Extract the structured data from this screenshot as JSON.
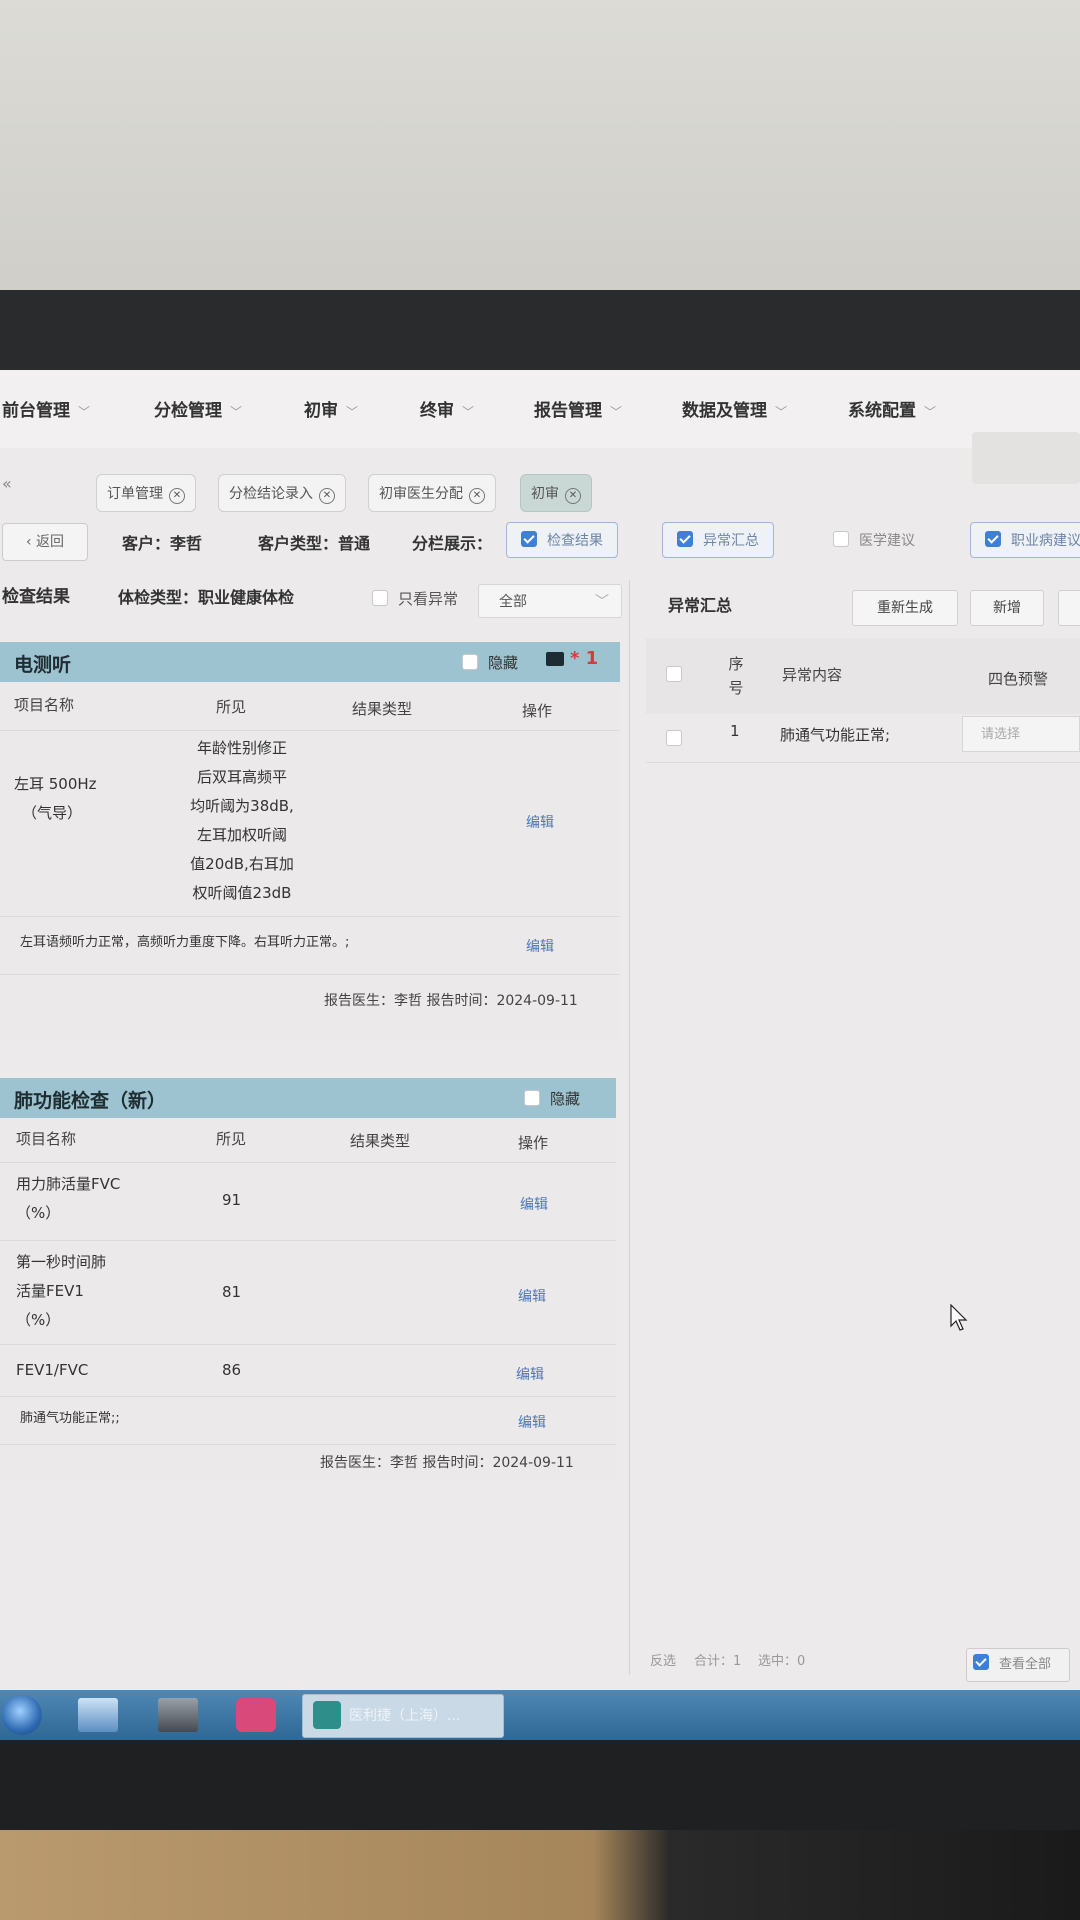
{
  "menu": [
    {
      "label": "前台管理"
    },
    {
      "label": "分检管理"
    },
    {
      "label": "初审"
    },
    {
      "label": "终审"
    },
    {
      "label": "报告管理"
    },
    {
      "label": "数据及管理"
    },
    {
      "label": "系统配置"
    }
  ],
  "collapse_symbol": "«",
  "tabs": [
    {
      "label": "订单管理"
    },
    {
      "label": "分检结论录入"
    },
    {
      "label": "初审医生分配"
    },
    {
      "label": "初审"
    }
  ],
  "customer_bar": {
    "back": "返回",
    "customer": "客户：李哲",
    "customer_type": "客户类型：普通",
    "column_display": "分栏展示：",
    "toggles": [
      {
        "label": "检查结果",
        "checked": true
      },
      {
        "label": "异常汇总",
        "checked": true
      },
      {
        "label": "医学建议",
        "checked": false
      },
      {
        "label": "职业病建议",
        "checked": true
      }
    ]
  },
  "left_panel": {
    "title": "检查结果",
    "exam_type": "体检类型：职业健康体检",
    "only_abnormal": "只看异常",
    "filter_value": "全部"
  },
  "columns": {
    "name": "项目名称",
    "finding": "所见",
    "result_type": "结果类型",
    "action": "操作"
  },
  "audiometry": {
    "title": "电测听",
    "hide": "隐藏",
    "marker": "* 1",
    "rows": [
      {
        "name_lines": [
          "左耳 500Hz",
          "（气导）"
        ],
        "finding_lines": [
          "年龄性别修正",
          "后双耳高频平",
          "均听阈为38dB,",
          "左耳加权听阈",
          "值20dB,右耳加",
          "权听阈值23dB"
        ],
        "action": "编辑"
      }
    ],
    "summary": "左耳语频听力正常，高频听力重度下降。右耳听力正常。;",
    "summary_action": "编辑",
    "sign": "报告医生：李哲 报告时间：2024-09-11"
  },
  "lung": {
    "title": "肺功能检查（新）",
    "hide": "隐藏",
    "rows": [
      {
        "name_lines": [
          "用力肺活量FVC",
          "（%）"
        ],
        "finding": "91",
        "action": "编辑"
      },
      {
        "name_lines": [
          "第一秒时间肺",
          "活量FEV1",
          "（%）"
        ],
        "finding": "81",
        "action": "编辑"
      },
      {
        "name_lines": [
          "FEV1/FVC"
        ],
        "finding": "86",
        "action": "编辑"
      }
    ],
    "summary": "肺通气功能正常;;",
    "summary_action": "编辑",
    "sign": "报告医生：李哲 报告时间：2024-09-11"
  },
  "right_panel": {
    "title": "异常汇总",
    "regenerate": "重新生成",
    "add": "新增",
    "headers": {
      "seq": "序号",
      "content": "异常内容",
      "warning": "四色预警"
    },
    "rows": [
      {
        "seq": "1",
        "content": "肺通气功能正常;",
        "warning_placeholder": "请选择"
      }
    ],
    "footer": {
      "invert": "反选",
      "total": "合计：1",
      "selected": "选中：0",
      "view_all": "查看全部"
    }
  },
  "taskbar": {
    "task_label": "医利捷（上海）..."
  }
}
